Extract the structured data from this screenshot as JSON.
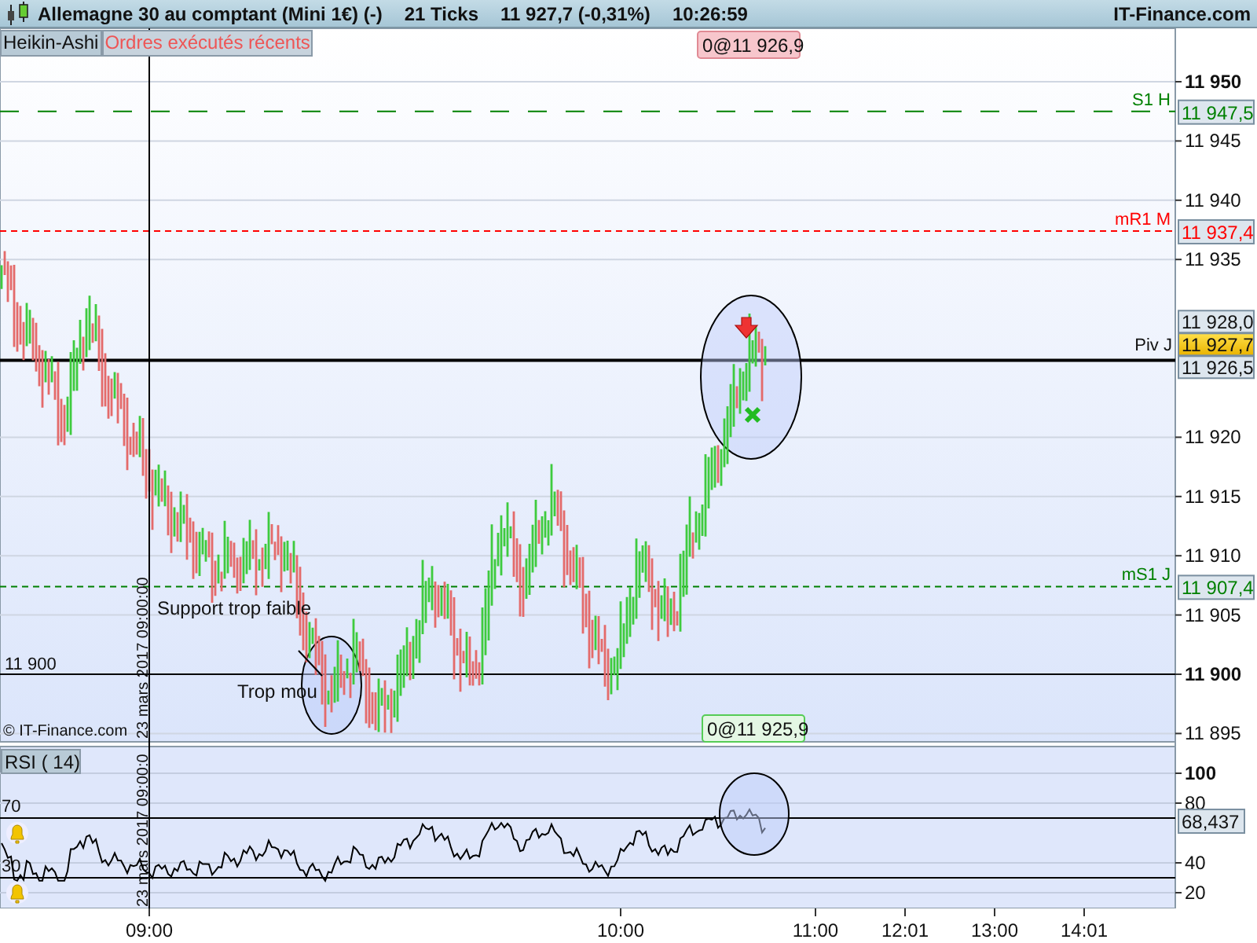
{
  "header": {
    "title": "Allemagne 30 au comptant (Mini 1€) (-)",
    "ticks": "21 Ticks",
    "price": "11 927,7 (-0,31%)",
    "time": "10:26:59",
    "brand": "IT-Finance.com"
  },
  "tabs": [
    {
      "label": "Heikin-Ashi",
      "kind": "style"
    },
    {
      "label": "Ordres exécutés récents",
      "kind": "orders"
    }
  ],
  "price_panel": {
    "axis_ticks": [
      {
        "label": "11 950",
        "bold": true
      },
      {
        "label": "11 945",
        "bold": false
      },
      {
        "label": "11 940",
        "bold": false
      },
      {
        "label": "11 935",
        "bold": false
      },
      {
        "label": "11 920",
        "bold": false
      },
      {
        "label": "11 915",
        "bold": false
      },
      {
        "label": "11 910",
        "bold": false
      },
      {
        "label": "11 905",
        "bold": false
      },
      {
        "label": "11 900",
        "bold": true
      },
      {
        "label": "11 895",
        "bold": false
      }
    ],
    "levels": [
      {
        "label": "S1 H",
        "value": "11 947,5",
        "color": "#008000",
        "kind": "dashed"
      },
      {
        "label": "mR1 M",
        "value": "11 937,4",
        "color": "#ff0000",
        "kind": "dotted"
      },
      {
        "label": "mS1 J",
        "value": "11 907,4",
        "color": "#008000",
        "kind": "dotted"
      }
    ],
    "markers": [
      {
        "value": "11 928,0",
        "kind": "high"
      },
      {
        "label": "Piv J",
        "value": "11 927,7",
        "kind": "last"
      },
      {
        "value": "11 926,5",
        "kind": "pivot"
      }
    ],
    "orders": [
      {
        "label": "0@11 926,9",
        "kind": "sell"
      },
      {
        "label": "0@11 925,9",
        "kind": "buy"
      }
    ],
    "date_marker": "23 mars 2017 09:00:00",
    "hline_label": "11 900",
    "annotations": [
      "Support trop faible",
      "Trop mou"
    ],
    "copyright": "© IT-Finance.com"
  },
  "rsi_panel": {
    "title": "RSI ( 14)",
    "axis_ticks": [
      "100",
      "80",
      "40",
      "20"
    ],
    "value": "68,437",
    "levels": [
      "70",
      "30"
    ],
    "date_marker": "23 mars 2017 09:00:0"
  },
  "time_axis": [
    "09:00",
    "10:00",
    "11:00",
    "12:01",
    "13:00",
    "14:01"
  ]
}
